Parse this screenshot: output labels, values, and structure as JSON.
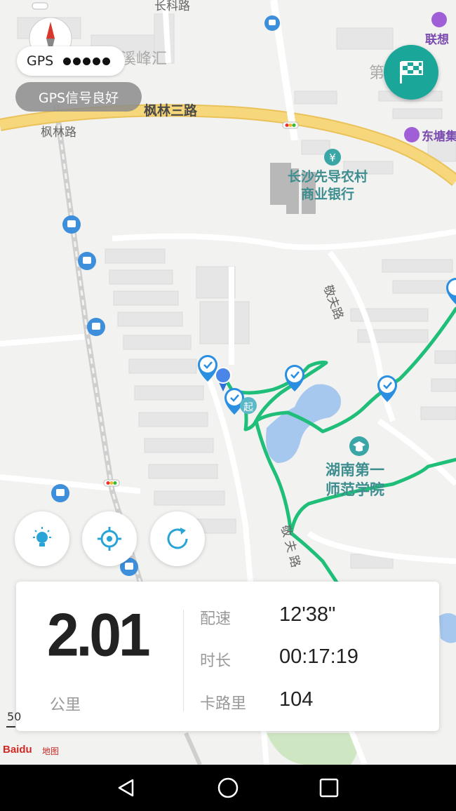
{
  "map": {
    "roads": {
      "fenglin_3rd_road": "枫林三路",
      "fenglin_road": "枫林路",
      "changke_road": "长科路",
      "jingfu_road": "敬夫路",
      "jingfu_road_lower": "敬 夫 路"
    },
    "places": {
      "xifeng_hui": "溪峰汇",
      "lenovo": "联想",
      "dongtang": "东塘集",
      "residential": "第 区",
      "bank_line1": "长沙先导农村",
      "bank_line2": "商业银行",
      "school_line1": "湖南第一",
      "school_line2": "师范学院"
    },
    "start_marker_text": "起",
    "track_color": "#1fbf7a",
    "icons": [
      "compass-icon",
      "bus-stop-icon",
      "bank-icon",
      "school-icon",
      "traffic-light-icon",
      "checkpoint-icon"
    ]
  },
  "gps": {
    "label": "GPS",
    "signal_level": 5,
    "status": "GPS信号良好"
  },
  "controls": {
    "finish_icon": "checkered-flag-icon",
    "light_icon": "light-bulb-icon",
    "locate_icon": "locate-icon",
    "refresh_icon": "refresh-icon"
  },
  "stats": {
    "distance": "2.01",
    "distance_unit": "公里",
    "pace_label": "配速",
    "pace_value": "12'38\"",
    "duration_label": "时长",
    "duration_value": "00:17:19",
    "calories_label": "卡路里",
    "calories_value": "104"
  },
  "map_footer": {
    "scale_text": "50",
    "logo_text": "Baidu",
    "logo_suffix": "地图"
  },
  "colors": {
    "accent": "#1aa79a",
    "track": "#1fbf7a",
    "checkpoint": "#2a8fe0",
    "main_road": "#f7d77b"
  }
}
